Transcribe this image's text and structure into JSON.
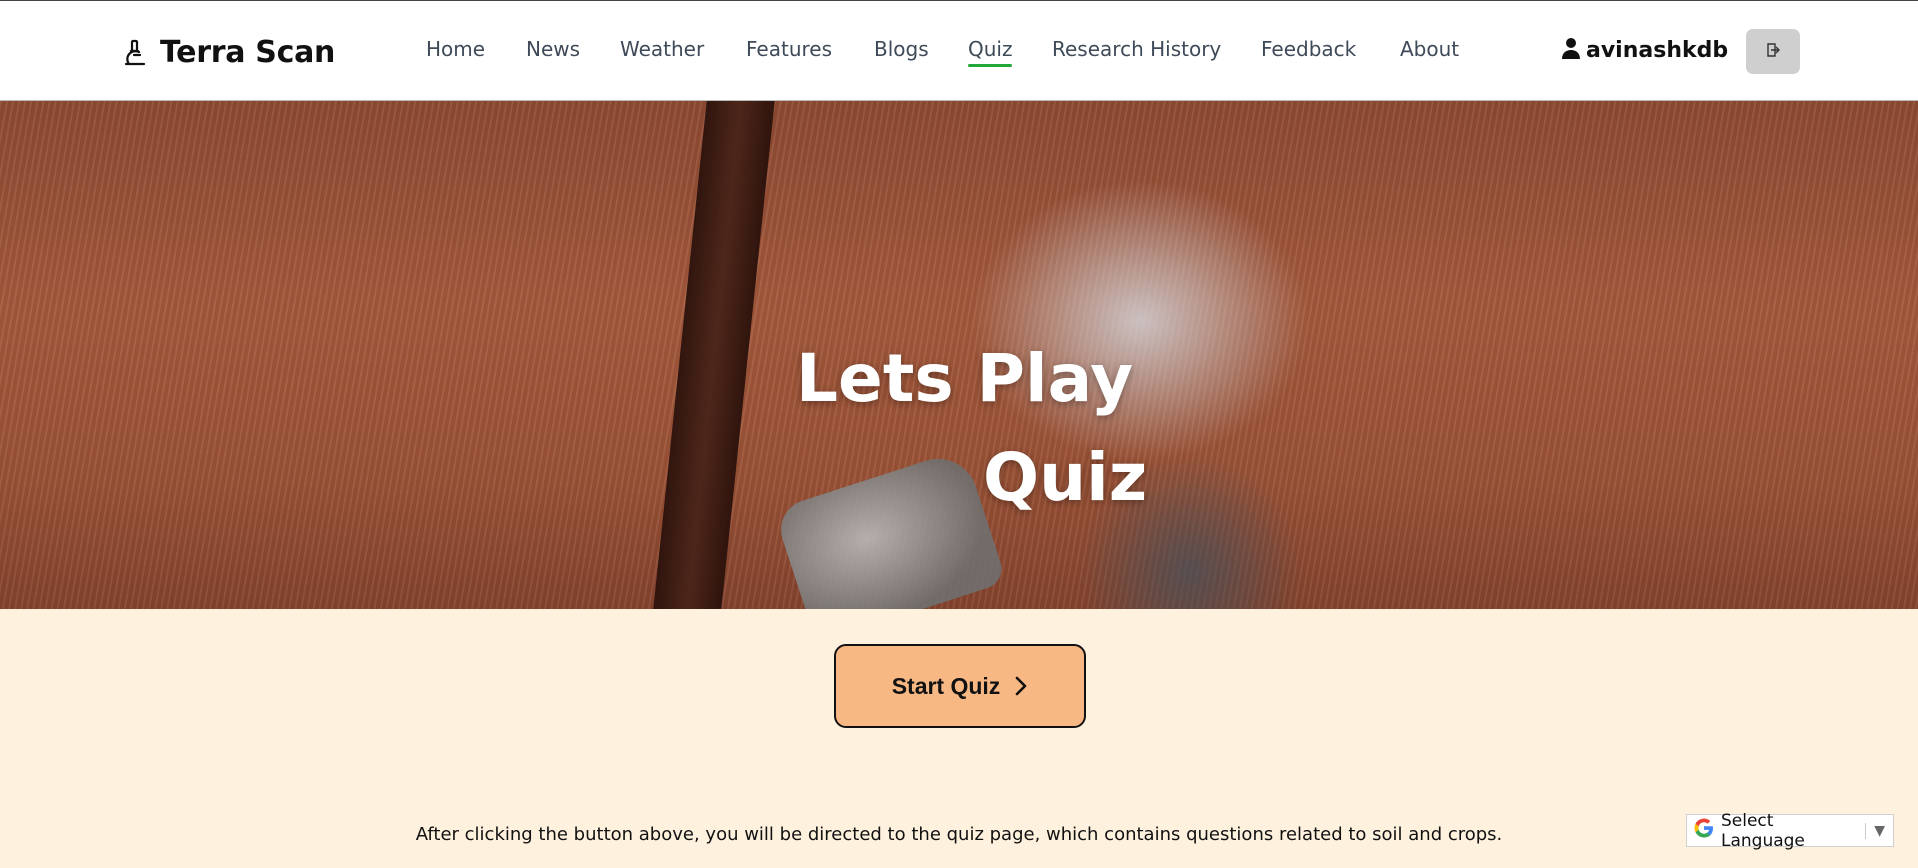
{
  "brand": {
    "name": "Terra Scan",
    "icon": "microscope-icon"
  },
  "nav": {
    "items": [
      {
        "label": "Home",
        "active": false
      },
      {
        "label": "News",
        "active": false
      },
      {
        "label": "Weather",
        "active": false
      },
      {
        "label": "Features",
        "active": false
      },
      {
        "label": "Blogs",
        "active": false
      },
      {
        "label": "Quiz",
        "active": true
      },
      {
        "label": "Research History",
        "active": false
      },
      {
        "label": "Feedback",
        "active": false
      },
      {
        "label": "About",
        "active": false
      }
    ],
    "active_underline_color": "#22a83a"
  },
  "user": {
    "name": "avinashkdb",
    "icon": "user-icon",
    "logout_icon": "logout-icon"
  },
  "hero": {
    "title_line1": "Lets Play",
    "title_line2": "Quiz"
  },
  "cta": {
    "label": "Start Quiz",
    "icon": "chevron-right-icon",
    "color": "#f8b884"
  },
  "info": {
    "text": "After clicking the button above, you will be directed to the quiz page, which contains questions related to soil and crops."
  },
  "language": {
    "label": "Select Language",
    "arrow": "▼",
    "icon": "google-g-icon"
  }
}
